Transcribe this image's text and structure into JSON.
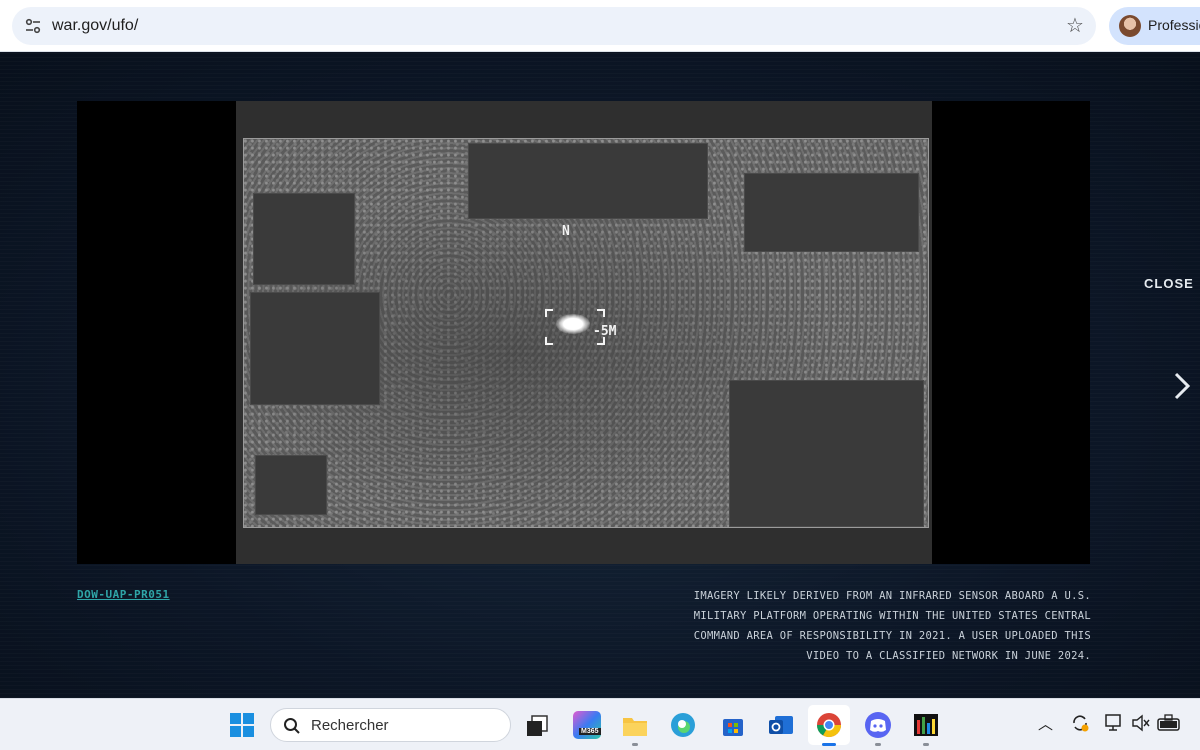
{
  "browser": {
    "url": "war.gov/ufo/",
    "profile_label": "Professio"
  },
  "viewer": {
    "hud_heading": "N",
    "hud_range": "-5M",
    "close_label": "CLOSE",
    "record_id": "DOW-UAP-PR051",
    "caption_lines": [
      "IMAGERY LIKELY DERIVED FROM AN INFRARED SENSOR ABOARD A U.S.",
      "MILITARY PLATFORM OPERATING WITHIN THE UNITED STATES CENTRAL",
      "COMMAND AREA OF RESPONSIBILITY IN 2021. A USER UPLOADED THIS",
      "VIDEO TO A CLASSIFIED NETWORK IN JUNE 2024."
    ]
  },
  "taskbar": {
    "search_placeholder": "Rechercher",
    "m365_badge": "M365",
    "icons": [
      "windows-start-icon",
      "task-view-icon",
      "m365-copilot-icon",
      "file-explorer-icon",
      "edge-icon",
      "microsoft-store-icon",
      "outlook-icon",
      "chrome-icon",
      "discord-icon",
      "resource-monitor-icon"
    ],
    "tray_icons": [
      "chevron-up-icon",
      "sync-icon",
      "display-icon",
      "volume-muted-icon",
      "battery-icon"
    ]
  },
  "colors": {
    "accent_link": "#2fa5a8",
    "page_bg": "#0c1626"
  }
}
